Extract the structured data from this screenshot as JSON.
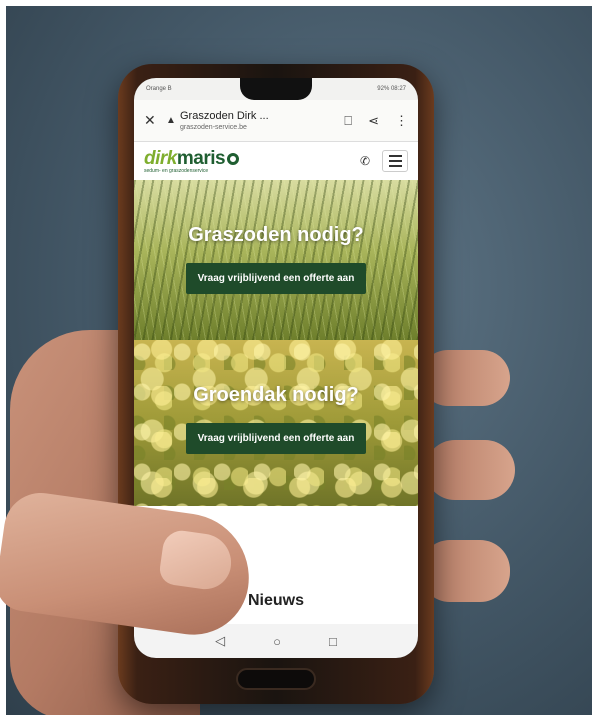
{
  "statusbar": {
    "left": "Orange B",
    "right": "92% 08:27"
  },
  "browser": {
    "close_icon": "close-icon",
    "title": "Graszoden Dirk ...",
    "domain": "graszoden-service.be",
    "icons": [
      "bookmark-icon",
      "share-icon",
      "more-icon"
    ]
  },
  "site": {
    "logo_dirk": "dirk",
    "logo_maris": "maris",
    "logo_sub": "sedum- en graszodenservice"
  },
  "hero_grass": {
    "title": "Graszoden nodig?",
    "cta": "Vraag vrijblijvend een offerte aan"
  },
  "hero_sedum": {
    "title": "Groendak nodig?",
    "cta": "Vraag vrijblijvend een offerte aan"
  },
  "news": {
    "title": "Nieuws"
  },
  "navbar": {
    "back": "◁",
    "home": "○",
    "recent": "□"
  },
  "colors": {
    "brand_dark_green": "#1f4b2a",
    "brand_light_green": "#7fae2e"
  }
}
